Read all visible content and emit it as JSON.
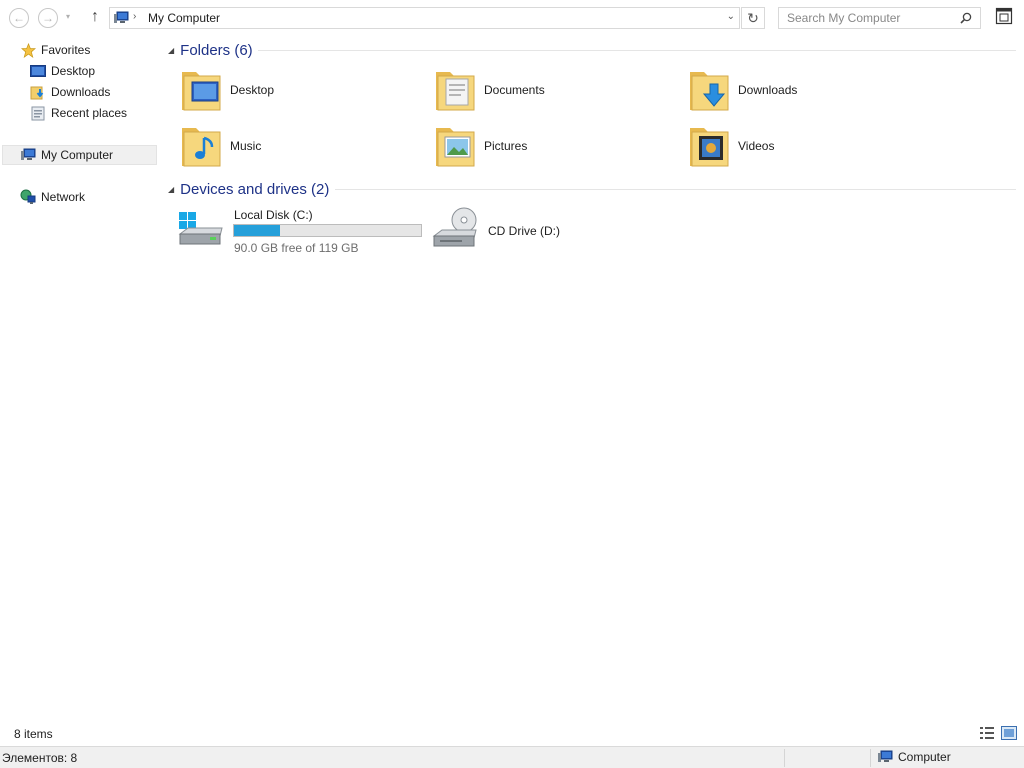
{
  "nav": {
    "back_glyph": "←",
    "forward_glyph": "→",
    "dropdown_glyph": "▾",
    "up_glyph": "↑"
  },
  "address": {
    "separator": "›",
    "path": "My Computer",
    "dropdown_glyph": "⌄",
    "refresh_glyph": "↻"
  },
  "search": {
    "placeholder": "Search My Computer"
  },
  "sidebar": {
    "favorites_label": "Favorites",
    "desktop_label": "Desktop",
    "downloads_label": "Downloads",
    "recent_label": "Recent places",
    "computer_label": "My Computer",
    "network_label": "Network"
  },
  "folders": {
    "title": "Folders (6)",
    "collapse_glyph": "◢",
    "items": [
      {
        "label": "Desktop",
        "icon": "desktop-folder-icon"
      },
      {
        "label": "Documents",
        "icon": "documents-folder-icon"
      },
      {
        "label": "Downloads",
        "icon": "downloads-folder-icon"
      },
      {
        "label": "Music",
        "icon": "music-folder-icon"
      },
      {
        "label": "Pictures",
        "icon": "pictures-folder-icon"
      },
      {
        "label": "Videos",
        "icon": "videos-folder-icon"
      }
    ]
  },
  "devices": {
    "title": "Devices and drives (2)",
    "collapse_glyph": "◢",
    "drives": [
      {
        "name": "Local Disk (C:)",
        "free_text": "90.0 GB free of 119 GB",
        "used_fraction": 0.244
      },
      {
        "name": "CD Drive (D:)"
      }
    ]
  },
  "status": {
    "items_count": "8 items",
    "bar_count": "Элементов: 8",
    "bar_location": "Computer"
  },
  "colors": {
    "accent_blue": "#26a0da",
    "group_title": "#1e3287",
    "folder_yellow": "#f2cf6b"
  }
}
